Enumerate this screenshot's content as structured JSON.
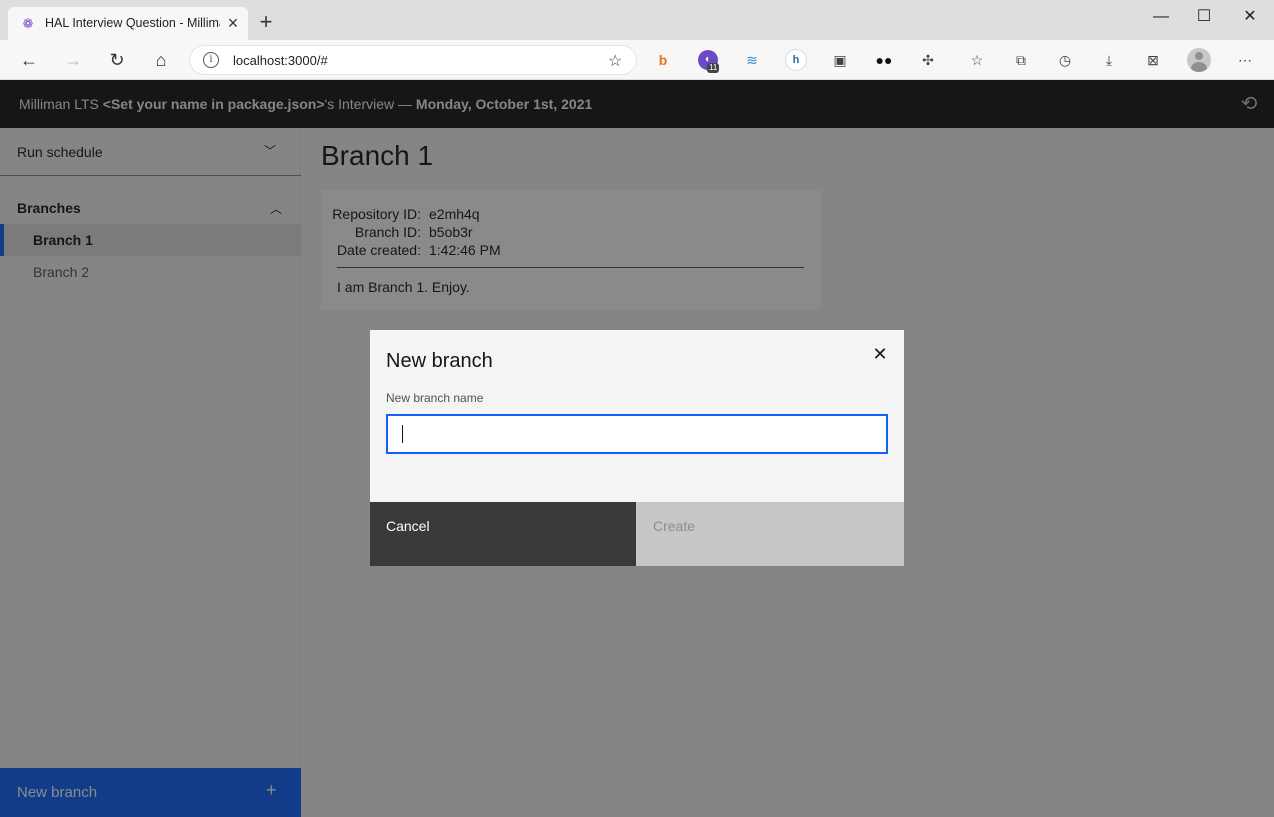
{
  "browser": {
    "tab_title": "HAL Interview Question - Milliman",
    "url": "localhost:3000/#",
    "extension_badge": "11"
  },
  "app": {
    "header_prefix": "Milliman LTS ",
    "header_bold": "<Set your name in package.json>",
    "header_suffix": "'s Interview — ",
    "header_date": "Monday, October 1st, 2021"
  },
  "sidebar": {
    "run_schedule_label": "Run schedule",
    "branches_label": "Branches",
    "branches": [
      {
        "label": "Branch 1",
        "active": true
      },
      {
        "label": "Branch 2",
        "active": false
      }
    ],
    "new_branch_label": "New branch"
  },
  "main": {
    "title": "Branch 1",
    "repository_id_label": "Repository ID:",
    "repository_id": "e2mh4q",
    "branch_id_label": "Branch ID:",
    "branch_id": "b5ob3r",
    "date_created_label": "Date created:",
    "date_created": "1:42:46 PM",
    "description": "I am Branch 1.  Enjoy."
  },
  "modal": {
    "title": "New branch",
    "field_label": "New branch name",
    "field_value": "",
    "cancel_label": "Cancel",
    "create_label": "Create"
  },
  "colors": {
    "accent": "#0f62fe",
    "header_bg": "#161616"
  }
}
